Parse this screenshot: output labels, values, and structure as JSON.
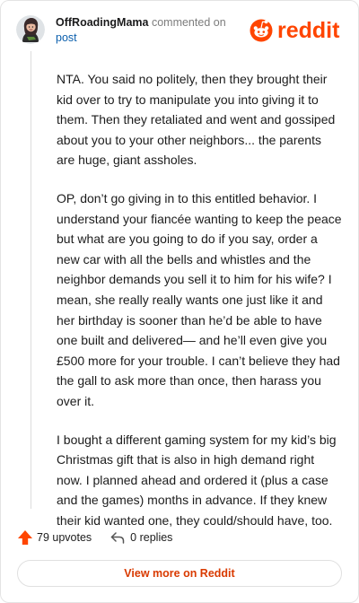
{
  "header": {
    "username": "OffRoadingMama",
    "action": " commented on",
    "post_label": "post",
    "logo_text": "reddit"
  },
  "comment": {
    "paragraphs": [
      "NTA. You said no politely, then they brought their kid over to try to manipulate you into giving it to them. Then they retaliated and went and gossiped about you to your other neighbors... the parents are huge, giant assholes.",
      "OP, don’t go giving in to this entitled behavior. I understand your fiancée wanting to keep the peace but what are you going to do if you say, order a new car with all the bells and whistles and the neighbor demands you sell it to him for his wife? I mean, she really really wants one just like it and her birthday is sooner than he’d be able to have one built and delivered— and he’ll even give you £500 more for your trouble. I can’t believe they had the gall to ask more than once, then harass you over it.",
      "I bought a different gaming system for my kid’s big Christmas gift that is also in high demand right now. I planned ahead and ordered it (plus a case and the games) months in advance. If they knew their kid wanted one, they could/should have, too."
    ]
  },
  "footer": {
    "upvotes": "79 upvotes",
    "replies": "0 replies",
    "view_more": "View more on Reddit"
  },
  "colors": {
    "brand": "#ff4500",
    "link": "#0b5fad",
    "view_more": "#d93a00"
  },
  "icons": {
    "avatar": "user-avatar",
    "logo": "reddit-snoo-icon",
    "upvote": "upvote-arrow-icon",
    "reply": "reply-arrow-icon"
  }
}
